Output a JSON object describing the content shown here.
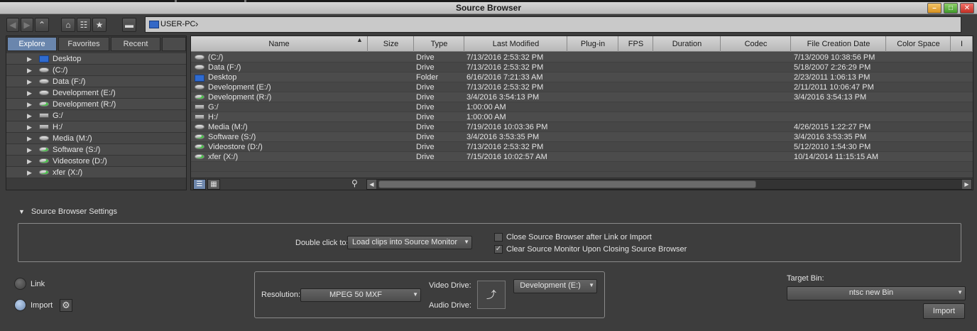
{
  "window": {
    "title": "Source Browser"
  },
  "toolbar": {
    "back_icon": "arrow-left-icon",
    "forward_icon": "arrow-right-icon",
    "up_icon": "arrow-up-icon",
    "home_icon": "home-icon",
    "tree_icon": "tree-icon",
    "favorite_icon": "star-icon",
    "drive_icon": "drive-icon",
    "path_label": "USER-PC"
  },
  "tabs": [
    {
      "label": "Explore",
      "active": true
    },
    {
      "label": "Favorites",
      "active": false
    },
    {
      "label": "Recent",
      "active": false
    }
  ],
  "tree": [
    {
      "label": "Desktop",
      "icon": "desktop"
    },
    {
      "label": "(C:/)",
      "icon": "drive"
    },
    {
      "label": "Data (F:/)",
      "icon": "drive"
    },
    {
      "label": "Development (E:/)",
      "icon": "drive"
    },
    {
      "label": "Development (R:/)",
      "icon": "drive-green"
    },
    {
      "label": "G:/",
      "icon": "net"
    },
    {
      "label": "H:/",
      "icon": "net"
    },
    {
      "label": "Media (M:/)",
      "icon": "drive"
    },
    {
      "label": "Software (S:/)",
      "icon": "drive-green"
    },
    {
      "label": "Videostore (D:/)",
      "icon": "drive-green"
    },
    {
      "label": "xfer (X:/)",
      "icon": "drive-green"
    }
  ],
  "columns": [
    "Name",
    "Size",
    "Type",
    "Last Modified",
    "Plug-in",
    "FPS",
    "Duration",
    "Codec",
    "File Creation Date",
    "Color Space",
    "I"
  ],
  "files": [
    {
      "name": "(C:/)",
      "type": "Drive",
      "modified": "7/13/2016 2:53:32 PM",
      "created": "7/13/2009 10:38:56 PM",
      "icon": "drive"
    },
    {
      "name": "Data (F:/)",
      "type": "Drive",
      "modified": "7/13/2016 2:53:32 PM",
      "created": "5/18/2007 2:26:29 PM",
      "icon": "drive"
    },
    {
      "name": "Desktop",
      "type": "Folder",
      "modified": "6/16/2016 7:21:33 AM",
      "created": "2/23/2011 1:06:13 PM",
      "icon": "desktop"
    },
    {
      "name": "Development (E:/)",
      "type": "Drive",
      "modified": "7/13/2016 2:53:32 PM",
      "created": "2/11/2011 10:06:47 PM",
      "icon": "drive"
    },
    {
      "name": "Development (R:/)",
      "type": "Drive",
      "modified": "3/4/2016 3:54:13 PM",
      "created": "3/4/2016 3:54:13 PM",
      "icon": "drive-green"
    },
    {
      "name": "G:/",
      "type": "Drive",
      "modified": "1:00:00 AM",
      "created": "",
      "icon": "net"
    },
    {
      "name": "H:/",
      "type": "Drive",
      "modified": "1:00:00 AM",
      "created": "",
      "icon": "net"
    },
    {
      "name": "Media (M:/)",
      "type": "Drive",
      "modified": "7/19/2016 10:03:36 PM",
      "created": "4/26/2015 1:22:27 PM",
      "icon": "drive"
    },
    {
      "name": "Software (S:/)",
      "type": "Drive",
      "modified": "3/4/2016 3:53:35 PM",
      "created": "3/4/2016 3:53:35 PM",
      "icon": "drive-green"
    },
    {
      "name": "Videostore (D:/)",
      "type": "Drive",
      "modified": "7/13/2016 2:53:32 PM",
      "created": "5/12/2010 1:54:30 PM",
      "icon": "drive-green"
    },
    {
      "name": "xfer (X:/)",
      "type": "Drive",
      "modified": "7/15/2016 10:02:57 AM",
      "created": "10/14/2014 11:15:15 AM",
      "icon": "drive-green"
    }
  ],
  "settings": {
    "title": "Source Browser Settings",
    "double_click_label": "Double click to:",
    "double_click_value": "Load clips into Source Monitor",
    "close_after_label": "Close Source Browser after Link or Import",
    "close_after_checked": false,
    "clear_monitor_label": "Clear Source Monitor Upon Closing Source Browser",
    "clear_monitor_checked": true
  },
  "mode": {
    "link_label": "Link",
    "import_label": "Import",
    "selected": "import"
  },
  "import_settings": {
    "resolution_label": "Resolution:",
    "resolution_value": "MPEG 50  MXF",
    "video_drive_label": "Video Drive:",
    "audio_drive_label": "Audio Drive:",
    "drive_value": "Development (E:)"
  },
  "target_bin": {
    "label": "Target Bin:",
    "value": "ntsc new Bin",
    "import_button": "Import"
  }
}
